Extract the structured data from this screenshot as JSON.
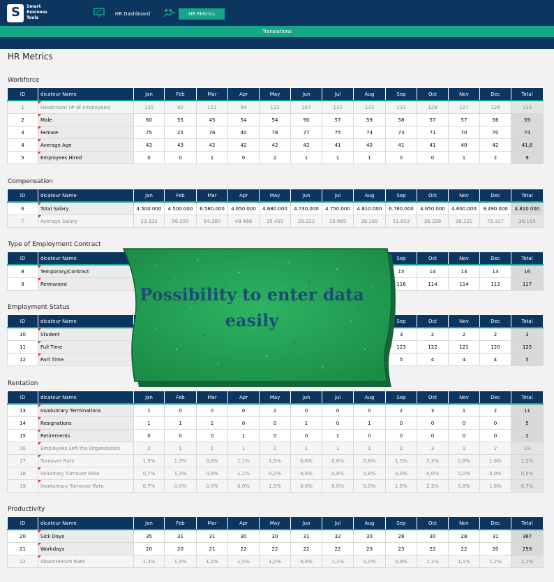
{
  "header": {
    "logo_lines": [
      "Smart",
      "Business",
      "Tools"
    ],
    "tabs": [
      {
        "label": "HR Dashboard",
        "icon": "presentation-icon"
      },
      {
        "label": "HR Metrics",
        "icon": "people-chart-icon"
      }
    ],
    "translations_label": "Translations"
  },
  "page": {
    "title": "HR Metrics"
  },
  "columns": [
    "ID",
    "dicateur Name",
    "Jan",
    "Feb",
    "Mar",
    "Apr",
    "May",
    "Jun",
    "Jul",
    "Aug",
    "Sep",
    "Oct",
    "Nov",
    "Dec",
    "Total"
  ],
  "sections": [
    {
      "title": "Workforce",
      "rows": [
        {
          "id": "1",
          "name": "Headcount (# of employees)",
          "calc": true,
          "values": [
            "135",
            "80",
            "121",
            "94",
            "132",
            "167",
            "132",
            "133",
            "131",
            "128",
            "127",
            "126",
            "133"
          ]
        },
        {
          "id": "2",
          "name": "Male",
          "calc": false,
          "values": [
            "60",
            "55",
            "45",
            "54",
            "54",
            "90",
            "57",
            "59",
            "58",
            "57",
            "57",
            "56",
            "59"
          ]
        },
        {
          "id": "3",
          "name": "Female",
          "calc": false,
          "values": [
            "75",
            "25",
            "76",
            "40",
            "78",
            "77",
            "75",
            "74",
            "73",
            "71",
            "70",
            "70",
            "74"
          ]
        },
        {
          "id": "4",
          "name": "Average Age",
          "calc": false,
          "values": [
            "43",
            "43",
            "42",
            "42",
            "42",
            "42",
            "41",
            "40",
            "41",
            "41",
            "40",
            "42",
            "41,6"
          ]
        },
        {
          "id": "5",
          "name": "Employees Hired",
          "calc": false,
          "values": [
            "0",
            "0",
            "1",
            "0",
            "2",
            "1",
            "1",
            "1",
            "0",
            "0",
            "1",
            "2",
            "9"
          ]
        }
      ]
    },
    {
      "title": "Compensation",
      "rows": [
        {
          "id": "6",
          "name": "Total Salary",
          "calc": false,
          "values": [
            "4.500.000",
            "4.500.000",
            "6.580.000",
            "4.650.000",
            "4.680.000",
            "4.730.000",
            "4.750.000",
            "4.810.000",
            "6.760.000",
            "4.650.000",
            "4.600.000",
            "9.490.000",
            "4.810.000"
          ]
        },
        {
          "id": "7",
          "name": "Average Salary",
          "calc": true,
          "values": [
            "33.333",
            "56.250",
            "54.380",
            "49.468",
            "35.455",
            "28.323",
            "35.985",
            "36.165",
            "51.603",
            "36.328",
            "36.220",
            "75.317",
            "36.165"
          ]
        }
      ]
    },
    {
      "title": "Type of Employment Contract",
      "rows": [
        {
          "id": "8",
          "name": "Temporary/Contract",
          "calc": false,
          "values": [
            "",
            "",
            "",
            "",
            "",
            "",
            "",
            "",
            "15",
            "14",
            "13",
            "13",
            "16"
          ]
        },
        {
          "id": "9",
          "name": "Permanent",
          "calc": false,
          "values": [
            "",
            "",
            "",
            "",
            "",
            "",
            "",
            "",
            "116",
            "114",
            "114",
            "113",
            "117"
          ]
        }
      ]
    },
    {
      "title": "Employment Status",
      "rows": [
        {
          "id": "10",
          "name": "Student",
          "calc": false,
          "values": [
            "",
            "",
            "",
            "",
            "",
            "",
            "",
            "",
            "3",
            "2",
            "2",
            "2",
            "3"
          ]
        },
        {
          "id": "11",
          "name": "Full Time",
          "calc": false,
          "values": [
            "",
            "",
            "",
            "",
            "",
            "",
            "",
            "",
            "123",
            "122",
            "121",
            "120",
            "125"
          ]
        },
        {
          "id": "12",
          "name": "Part Time",
          "calc": false,
          "values": [
            "",
            "",
            "",
            "",
            "",
            "",
            "",
            "",
            "5",
            "4",
            "4",
            "4",
            "5"
          ]
        }
      ]
    },
    {
      "title": "Rentation",
      "rows": [
        {
          "id": "13",
          "name": "Involuntary Terminations",
          "calc": false,
          "values": [
            "1",
            "0",
            "0",
            "0",
            "2",
            "0",
            "0",
            "0",
            "2",
            "3",
            "1",
            "2",
            "11"
          ]
        },
        {
          "id": "14",
          "name": "Resignations",
          "calc": false,
          "values": [
            "1",
            "1",
            "1",
            "0",
            "0",
            "1",
            "0",
            "1",
            "0",
            "0",
            "0",
            "0",
            "5"
          ]
        },
        {
          "id": "15",
          "name": "Retirements",
          "calc": false,
          "values": [
            "0",
            "0",
            "0",
            "1",
            "0",
            "0",
            "1",
            "0",
            "0",
            "0",
            "0",
            "0",
            "2"
          ]
        },
        {
          "id": "16",
          "name": "Employees Left the Organization",
          "calc": true,
          "values": [
            "2",
            "1",
            "1",
            "1",
            "2",
            "1",
            "1",
            "1",
            "2",
            "3",
            "1",
            "2",
            "18"
          ]
        },
        {
          "id": "17",
          "name": "Turnover Rate",
          "calc": true,
          "values": [
            "1,5%",
            "1,3%",
            "0,8%",
            "1,1%",
            "1,5%",
            "0,6%",
            "0,8%",
            "0,8%",
            "1,5%",
            "2,3%",
            "0,8%",
            "1,6%",
            "1,2%"
          ]
        },
        {
          "id": "18",
          "name": "Voluntary Turnover Rate",
          "calc": true,
          "values": [
            "0,7%",
            "1,3%",
            "0,8%",
            "1,1%",
            "0,0%",
            "0,6%",
            "0,8%",
            "0,8%",
            "0,0%",
            "0,0%",
            "0,0%",
            "0,0%",
            "0,5%"
          ]
        },
        {
          "id": "19",
          "name": "Involuntary Turnover Rate",
          "calc": true,
          "values": [
            "0,7%",
            "0,0%",
            "0,0%",
            "0,0%",
            "1,5%",
            "0,0%",
            "0,0%",
            "0,0%",
            "1,5%",
            "2,3%",
            "0,8%",
            "1,6%",
            "0,7%"
          ]
        }
      ]
    },
    {
      "title": "Productivity",
      "rows": [
        {
          "id": "20",
          "name": "Sick Days",
          "calc": false,
          "values": [
            "35",
            "31",
            "31",
            "30",
            "30",
            "31",
            "32",
            "30",
            "28",
            "30",
            "28",
            "31",
            "367"
          ]
        },
        {
          "id": "21",
          "name": "Workdays",
          "calc": false,
          "values": [
            "20",
            "20",
            "21",
            "22",
            "22",
            "22",
            "22",
            "23",
            "23",
            "22",
            "22",
            "20",
            "259"
          ]
        },
        {
          "id": "22",
          "name": "Absenteeism Rate",
          "calc": true,
          "values": [
            "1,3%",
            "1,9%",
            "1,2%",
            "1,5%",
            "1,0%",
            "0,8%",
            "1,1%",
            "1,0%",
            "0,9%",
            "1,1%",
            "1,1%",
            "1,2%",
            "1,1%"
          ]
        }
      ]
    }
  ],
  "banner": {
    "line1": "Possibility to enter data",
    "line2": "easily"
  },
  "colors": {
    "navy": "#0c3560",
    "teal": "#17a589",
    "banner_green": "#1f9a4f"
  }
}
